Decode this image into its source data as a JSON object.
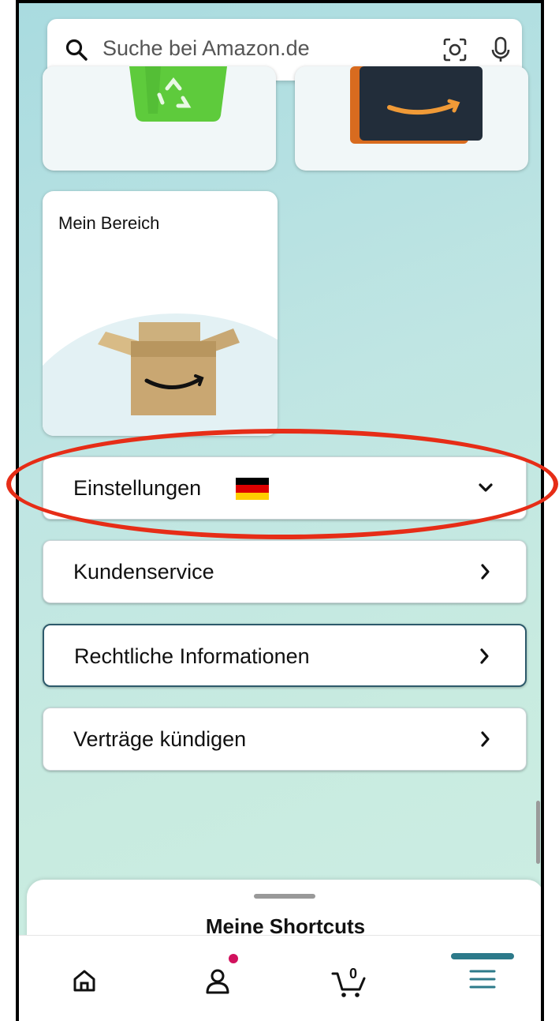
{
  "search": {
    "placeholder": "Suche bei Amazon.de"
  },
  "tiles": {
    "mein_bereich": "Mein Bereich"
  },
  "menu": {
    "einstellungen": "Einstellungen",
    "kundenservice": "Kundenservice",
    "rechtliche": "Rechtliche Informationen",
    "vertraege": "Verträge kündigen"
  },
  "sheet": {
    "title": "Meine Shortcuts"
  },
  "nav": {
    "cart_count": "0"
  },
  "colors": {
    "highlight": "#e62d17",
    "accent": "#2d7a8a",
    "badge": "#d1115d"
  }
}
